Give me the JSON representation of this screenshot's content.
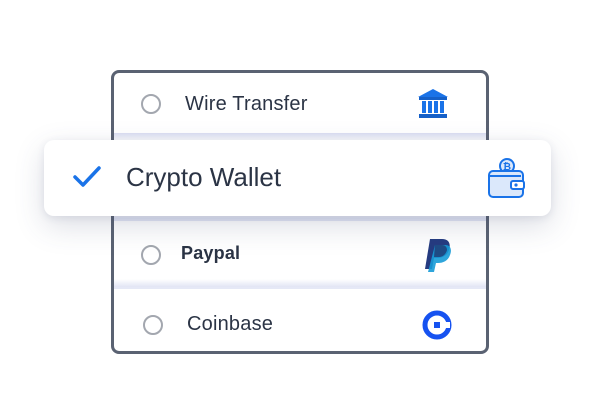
{
  "options": [
    {
      "label": "Wire Transfer",
      "icon": "bank-icon",
      "selected": false
    },
    {
      "label": "Crypto Wallet",
      "icon": "wallet-icon",
      "selected": true
    },
    {
      "label": "Paypal",
      "icon": "paypal-icon",
      "selected": false
    },
    {
      "label": "Coinbase",
      "icon": "coinbase-icon",
      "selected": false
    }
  ],
  "colors": {
    "accent": "#1a73e8",
    "border": "#5a6272",
    "text": "#2b3445",
    "radio": "#a3a7af",
    "paypal_dark": "#253b80",
    "paypal_light": "#179bd7",
    "coinbase": "#1652f0"
  }
}
